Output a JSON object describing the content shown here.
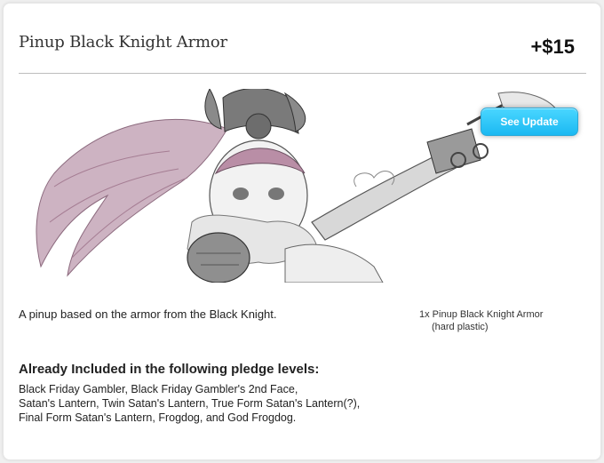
{
  "reward": {
    "title": "Pinup Black Knight Armor",
    "price": "+$15",
    "update_button": "See Update",
    "description": "A pinup based on the armor from the Black Knight.",
    "item_line1": "1x Pinup Black Knight Armor",
    "item_line2": "(hard plastic)",
    "included_heading": "Already Included in the following pledge levels:",
    "included_lines": [
      "Black Friday Gambler, Black Friday Gambler's 2nd Face,",
      "Satan's Lantern, Twin Satan's Lantern, True Form Satan's Lantern(?),",
      "Final Form Satan's Lantern, Frogdog, and God Frogdog."
    ]
  },
  "colors": {
    "accent_button": "#1bb9f2",
    "hair_pink": "#b07a98"
  }
}
